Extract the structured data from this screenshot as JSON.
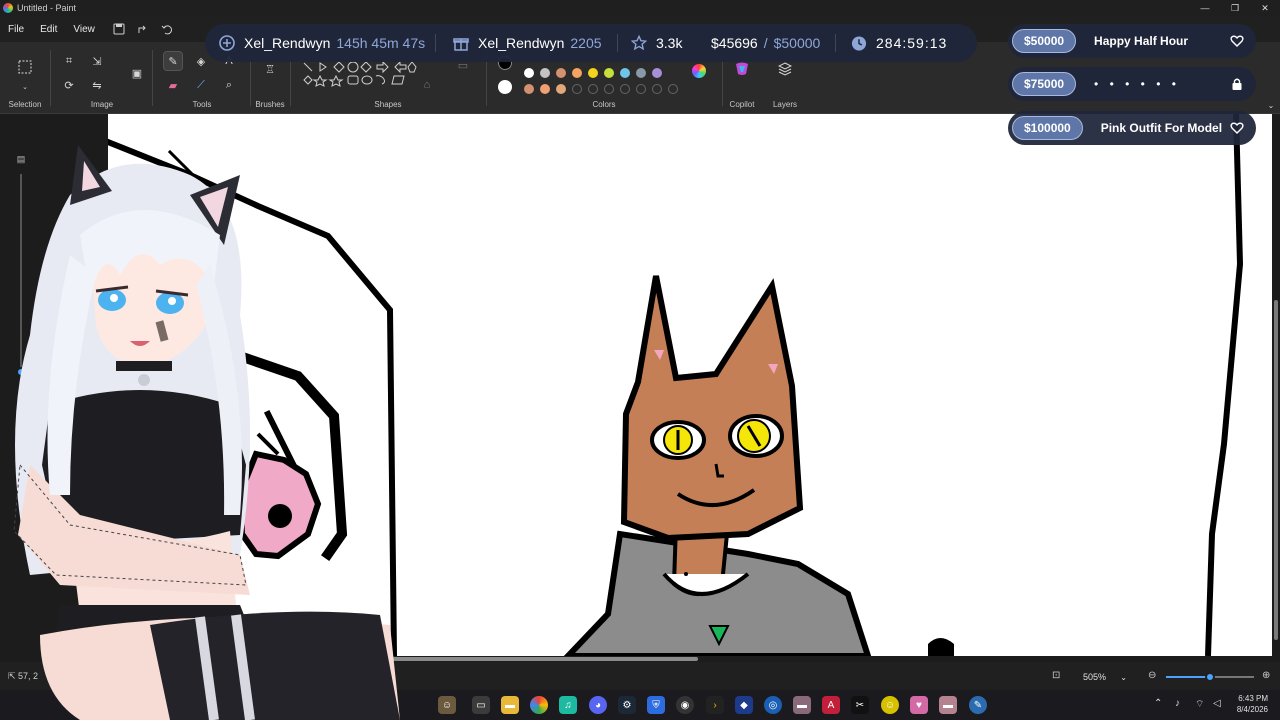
{
  "window": {
    "title": "Untitled - Paint",
    "controls": [
      "—",
      "❐",
      "✕"
    ]
  },
  "menu": {
    "file": "File",
    "edit": "Edit",
    "view": "View"
  },
  "ribbon": {
    "groups": {
      "selection": "Selection",
      "image": "Image",
      "tools": "Tools",
      "brushes": "Brushes",
      "shapes": "Shapes",
      "colors": "Colors",
      "copilot": "Copilot",
      "layers": "Layers"
    },
    "colors": {
      "primary": "#000000",
      "secondary": "#ffffff",
      "palette_row1": [
        "#ffffff",
        "#c3c3c3",
        "#d4916f",
        "#f4a460",
        "#f5d31c",
        "#c6e03a",
        "#70c4e8",
        "#8899aa",
        "#a88fd9"
      ],
      "palette_row2": [
        "#d4916f",
        "#f0a070",
        "#e3a77a"
      ]
    }
  },
  "status": {
    "cursor_position": "57, 2",
    "zoom_label": "505%",
    "zoom_fraction": 0.5
  },
  "taskbar": {
    "time": "6:43 PM",
    "date": "8/4/2026"
  },
  "overlay": {
    "stats": {
      "follower_name": "Xel_Rendwyn",
      "follower_time": "145h 45m 47s",
      "gift_name": "Xel_Rendwyn",
      "gift_count": "2205",
      "stars": "3.3k",
      "money_raised": "$45696",
      "money_divider": "/",
      "money_goal": "$50000",
      "timer": "284:59:13"
    },
    "goals": [
      {
        "amount": "$50000",
        "label": "Happy Half Hour",
        "icon": "heart-icon"
      },
      {
        "amount": "$75000",
        "label": "• • • • • •",
        "icon": "lock-icon"
      },
      {
        "amount": "$100000",
        "label": "Pink Outfit For Model",
        "icon": "heart-icon"
      }
    ]
  }
}
